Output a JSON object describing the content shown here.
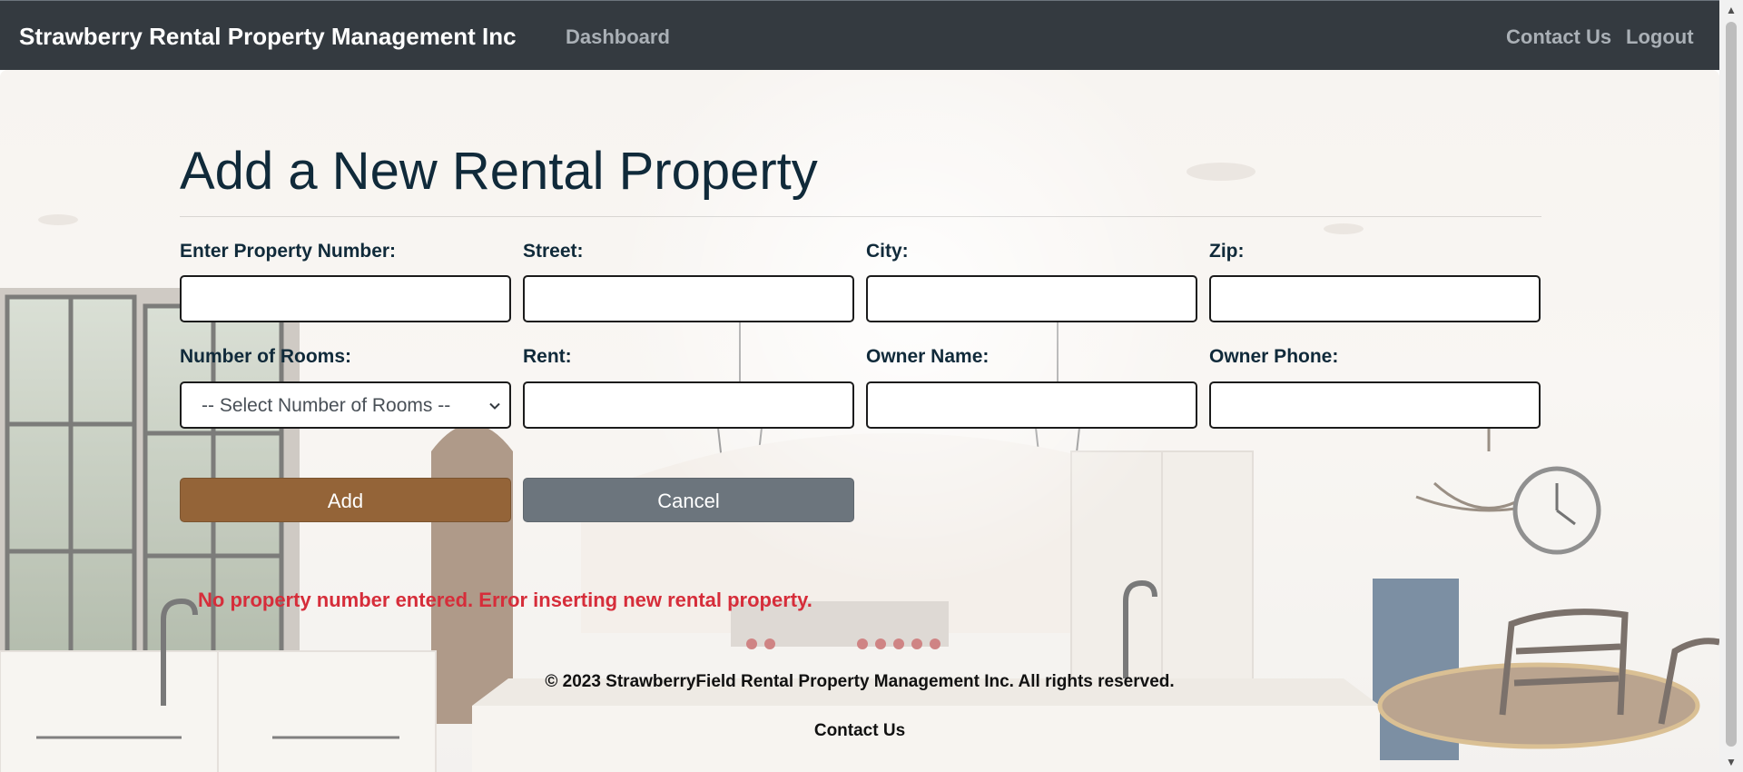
{
  "navbar": {
    "brand": "Strawberry Rental Property Management Inc",
    "links": {
      "dashboard": "Dashboard",
      "contact": "Contact Us",
      "logout": "Logout"
    }
  },
  "form": {
    "title": "Add a New Rental Property",
    "fields": {
      "property_number": {
        "label": "Enter Property Number:",
        "value": ""
      },
      "street": {
        "label": "Street:",
        "value": ""
      },
      "city": {
        "label": "City:",
        "value": ""
      },
      "zip": {
        "label": "Zip:",
        "value": ""
      },
      "rooms": {
        "label": "Number of Rooms:",
        "selected": "-- Select Number of Rooms --"
      },
      "rent": {
        "label": "Rent:",
        "value": ""
      },
      "owner_name": {
        "label": "Owner Name:",
        "value": ""
      },
      "owner_phone": {
        "label": "Owner Phone:",
        "value": ""
      }
    },
    "buttons": {
      "add": "Add",
      "cancel": "Cancel"
    },
    "error": "No property number entered. Error inserting new rental property."
  },
  "footer": {
    "copyright": "© 2023 StrawberryField Rental Property Management Inc. All rights reserved.",
    "contact": "Contact Us"
  },
  "colors": {
    "navbar": "#343a40",
    "nav_link": "#aab0b6",
    "title": "#102a3a",
    "add_button": "#946438",
    "cancel_button": "#6c757d",
    "error": "#d62d3a"
  },
  "icons": {
    "select_chevron": "chevron-down-icon",
    "scroll_up": "scroll-up-arrow-icon",
    "scroll_down": "scroll-down-arrow-icon"
  }
}
